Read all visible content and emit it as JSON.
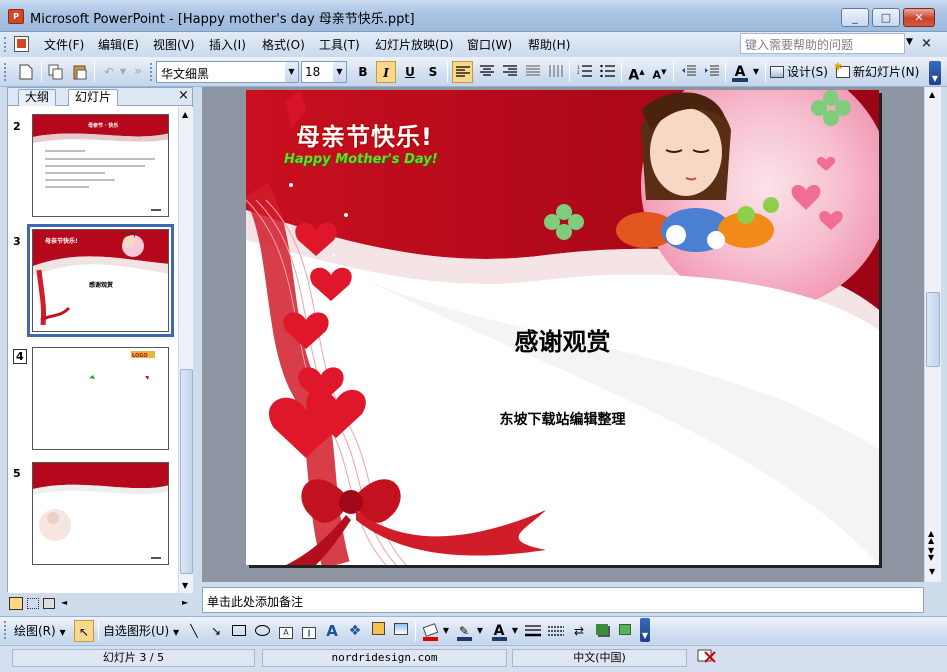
{
  "window": {
    "title": "Microsoft PowerPoint - [Happy mother's day 母亲节快乐.ppt]",
    "app_icon_label": "P",
    "minimize": "_",
    "maximize": "□",
    "close": "✕"
  },
  "menu": {
    "items": [
      "文件(F)",
      "编辑(E)",
      "视图(V)",
      "插入(I)",
      "格式(O)",
      "工具(T)",
      "幻灯片放映(D)",
      "窗口(W)",
      "帮助(H)"
    ],
    "help_placeholder": "键入需要帮助的问题"
  },
  "toolbar": {
    "font_name": "华文细黑",
    "font_size": "18",
    "bold": "B",
    "italic": "I",
    "underline": "U",
    "shadow": "S",
    "design_label": "设计(S)",
    "new_slide_label": "新幻灯片(N)"
  },
  "left_pane": {
    "tab_outline": "大纲",
    "tab_slides": "幻灯片",
    "close": "×",
    "thumbnails": [
      {
        "number": "2"
      },
      {
        "number": "3",
        "selected": true
      },
      {
        "number": "4"
      },
      {
        "number": "5"
      }
    ]
  },
  "slide": {
    "header_cn": "母亲节快乐!",
    "header_en": "Happy Mother's Day!",
    "title": "感谢观赏",
    "subtitle": "东坡下载站编辑整理"
  },
  "notes": {
    "placeholder": "单击此处添加备注"
  },
  "drawing_toolbar": {
    "draw_label": "绘图(R)",
    "autoshapes_label": "自选图形(U)"
  },
  "status": {
    "slide_info": "幻灯片 3 / 5",
    "template": "nordridesign.com",
    "language": "中文(中国)"
  },
  "colors": {
    "slide_red": "#b5081c",
    "selection_blue": "#3c69b4",
    "title_bar": "#a9c3e2"
  }
}
